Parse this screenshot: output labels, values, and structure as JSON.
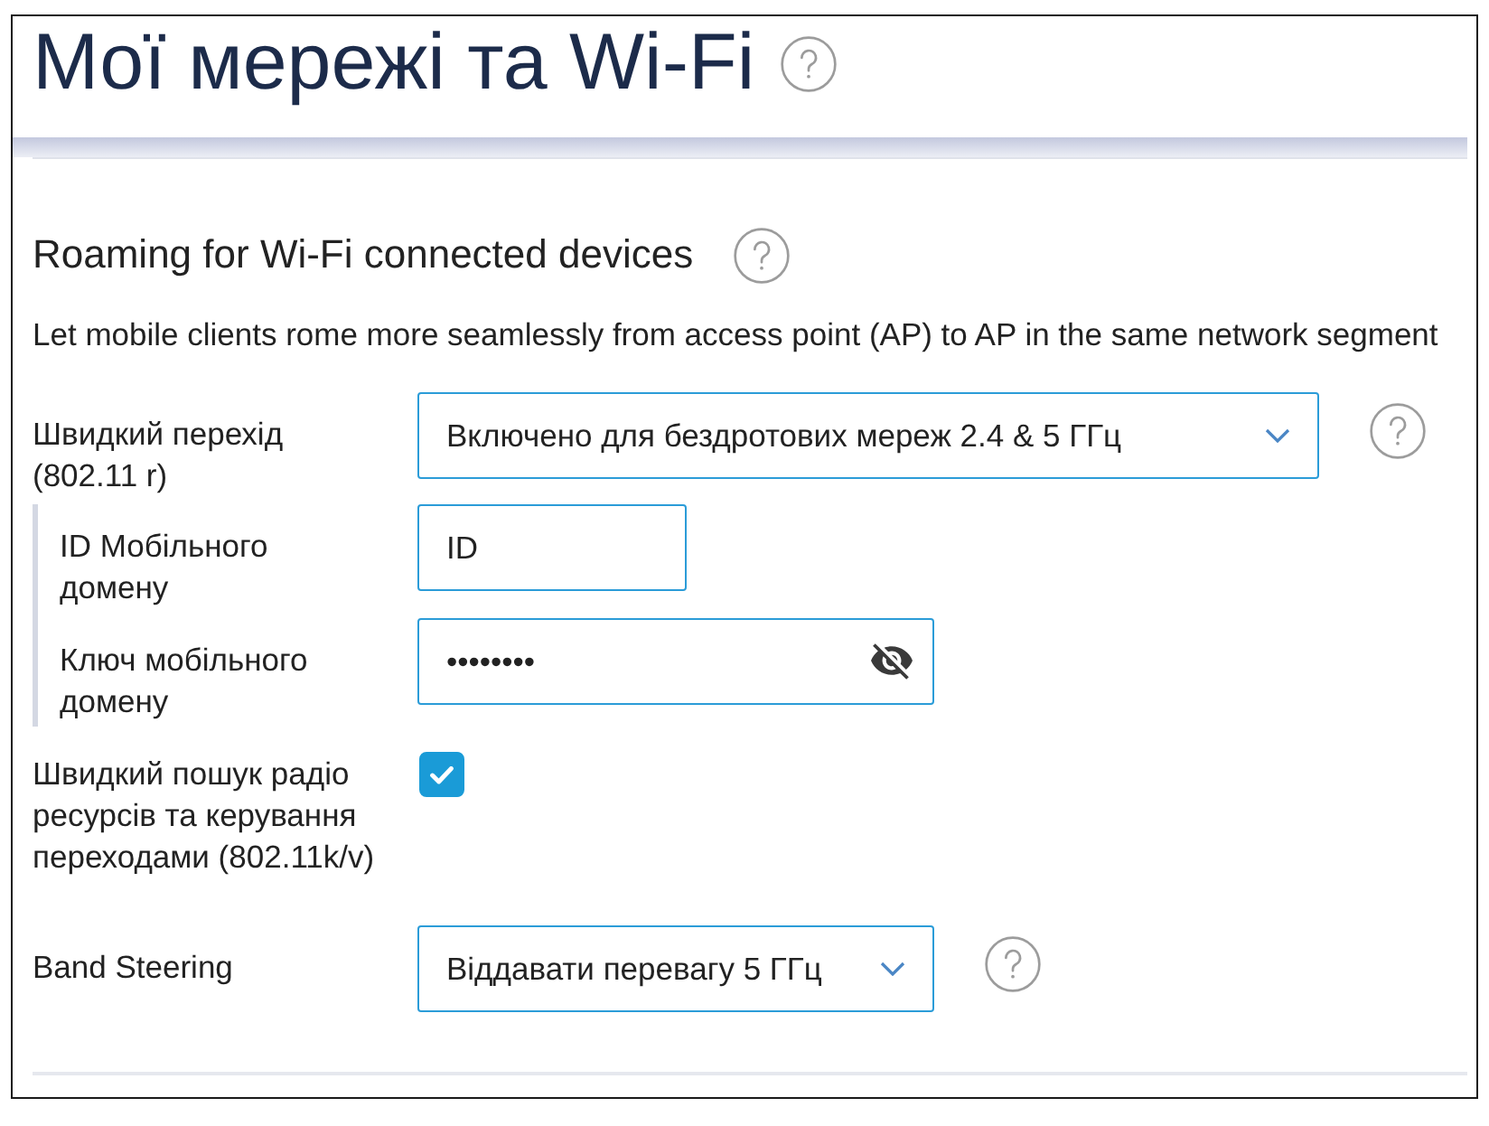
{
  "page": {
    "title": "Мої мережі та Wi-Fi"
  },
  "section": {
    "title": "Roaming for Wi-Fi connected devices",
    "description": "Let mobile clients rome more seamlessly from access point (AP) to AP in the same network segment"
  },
  "settings": [
    {
      "kind": "select",
      "label": "Швидкий перехід (802.11 r)",
      "value": "Включено для бездротових мереж 2.4 & 5 ГГц",
      "help": true,
      "children": [
        {
          "kind": "text",
          "label": "ID Мобільного домену",
          "value": "ID"
        },
        {
          "kind": "password",
          "label": "Ключ мобільного домену",
          "value": "••••••••",
          "revealed": false
        }
      ]
    },
    {
      "kind": "checkbox",
      "label": "Швидкий пошук радіо ресурсів та керування переходами (802.11k/v)",
      "checked": true,
      "help": false
    },
    {
      "kind": "select",
      "label": "Band Steering",
      "value": "Віддавати перевагу 5 ГГц",
      "help": true
    }
  ]
}
